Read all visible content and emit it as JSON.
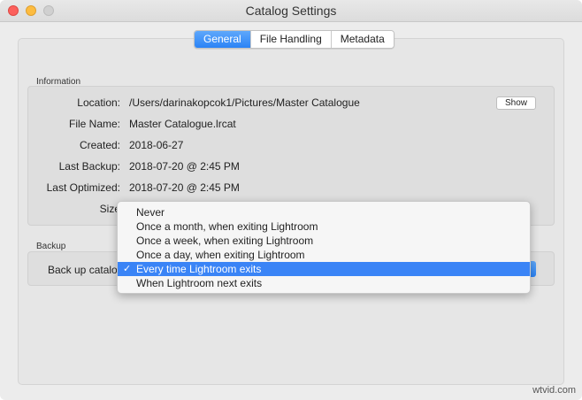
{
  "window": {
    "title": "Catalog Settings"
  },
  "tabs": [
    {
      "label": "General",
      "active": true
    },
    {
      "label": "File Handling",
      "active": false
    },
    {
      "label": "Metadata",
      "active": false
    }
  ],
  "information": {
    "section_label": "Information",
    "location_label": "Location:",
    "location_value": "/Users/darinakopcok1/Pictures/Master Catalogue",
    "show_button": "Show",
    "file_name_label": "File Name:",
    "file_name_value": "Master Catalogue.lrcat",
    "created_label": "Created:",
    "created_value": "2018-06-27",
    "last_backup_label": "Last Backup:",
    "last_backup_value": "2018-07-20 @ 2:45 PM",
    "last_optimized_label": "Last Optimized:",
    "last_optimized_value": "2018-07-20 @ 2:45 PM",
    "size_label": "Size"
  },
  "backup": {
    "section_label": "Backup",
    "back_up_label": "Back up catalo",
    "menu_items": [
      {
        "label": "Never",
        "selected": false
      },
      {
        "label": "Once a month, when exiting Lightroom",
        "selected": false
      },
      {
        "label": "Once a week, when exiting Lightroom",
        "selected": false
      },
      {
        "label": "Once a day, when exiting Lightroom",
        "selected": false
      },
      {
        "label": "Every time Lightroom exits",
        "selected": true
      },
      {
        "label": "When Lightroom next exits",
        "selected": false
      }
    ],
    "checkmark": "✓"
  },
  "watermark": "wtvid.com",
  "colors": {
    "accent": "#2b83f6",
    "selection": "#3a84f6",
    "close": "#fc605c",
    "minimize": "#fdbc40"
  }
}
